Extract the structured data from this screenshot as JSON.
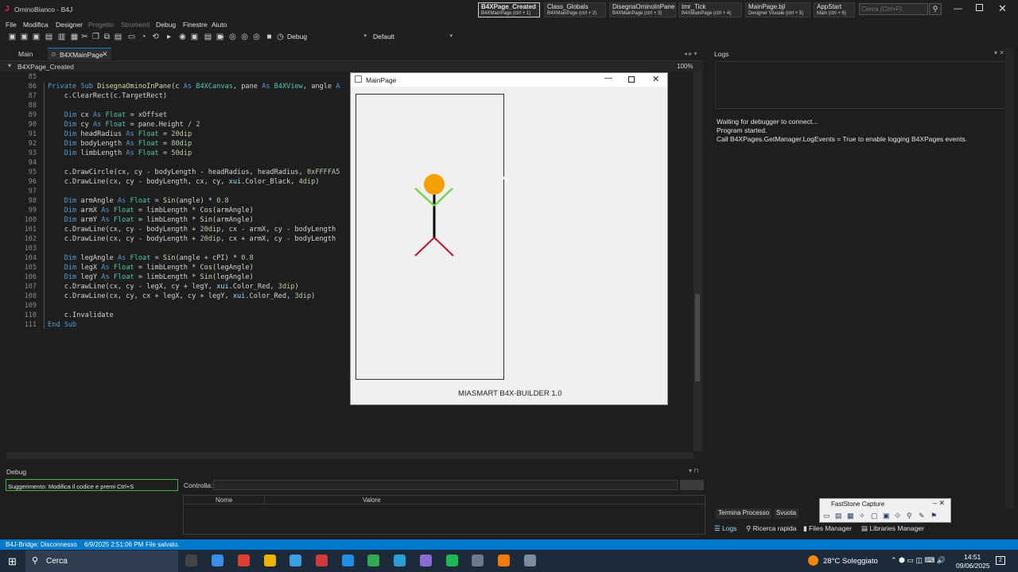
{
  "window": {
    "title": "OminoBianco - B4J"
  },
  "quick_tabs": [
    {
      "title": "B4XPage_Created",
      "sub": "B4XMainPage (ctrl + 1)"
    },
    {
      "title": "Class_Globals",
      "sub": "B4XMainPage (ctrl + 2)"
    },
    {
      "title": "DisegnaOminoInPane",
      "sub": "B4XMainPage (ctrl + 3)"
    },
    {
      "title": "tmr_Tick",
      "sub": "B4XMainPage (ctrl + 4)"
    },
    {
      "title": "MainPage.bjl",
      "sub": "Designer Visuale (ctrl + 5)"
    },
    {
      "title": "AppStart",
      "sub": "Main (ctrl + 6)"
    }
  ],
  "search": {
    "placeholder": "Cerca (Ctrl+F)"
  },
  "menu": [
    "File",
    "Modifica",
    "Designer",
    "Progetto",
    "Strumenti",
    "Debug",
    "Finestre",
    "Aiuto"
  ],
  "toolbar": {
    "config": "Debug",
    "build": "Default"
  },
  "editor_tabs": [
    "Main",
    "B4XMainPage"
  ],
  "sub_dropdown": "B4XPage_Created",
  "zoom": "100%",
  "code": [
    {
      "n": "85",
      "t": []
    },
    {
      "n": "86",
      "t": [
        [
          "kw",
          "Private Sub "
        ],
        [
          "fn",
          "DisegnaOminoInPane"
        ],
        [
          "id",
          "(c "
        ],
        [
          "kw",
          "As "
        ],
        [
          "ty",
          "B4XCanvas"
        ],
        [
          "id",
          ", pane "
        ],
        [
          "kw",
          "As "
        ],
        [
          "ty",
          "B4XView"
        ],
        [
          "id",
          ", angle "
        ],
        [
          "kw",
          "A"
        ]
      ]
    },
    {
      "n": "87",
      "t": [
        [
          "id",
          "    c.ClearRect(c.TargetRect)"
        ]
      ]
    },
    {
      "n": "88",
      "t": []
    },
    {
      "n": "89",
      "t": [
        [
          "kw",
          "    Dim "
        ],
        [
          "id",
          "cx "
        ],
        [
          "kw",
          "As "
        ],
        [
          "ty",
          "Float"
        ],
        [
          "id",
          " = xOffset"
        ]
      ]
    },
    {
      "n": "90",
      "t": [
        [
          "kw",
          "    Dim "
        ],
        [
          "id",
          "cy "
        ],
        [
          "kw",
          "As "
        ],
        [
          "ty",
          "Float"
        ],
        [
          "id",
          " = pane.Height / "
        ],
        [
          "nm",
          "2"
        ]
      ]
    },
    {
      "n": "91",
      "t": [
        [
          "kw",
          "    Dim "
        ],
        [
          "id",
          "headRadius "
        ],
        [
          "kw",
          "As "
        ],
        [
          "ty",
          "Float"
        ],
        [
          "id",
          " = "
        ],
        [
          "nm",
          "20dip"
        ]
      ]
    },
    {
      "n": "92",
      "t": [
        [
          "kw",
          "    Dim "
        ],
        [
          "id",
          "bodyLength "
        ],
        [
          "kw",
          "As "
        ],
        [
          "ty",
          "Float"
        ],
        [
          "id",
          " = "
        ],
        [
          "nm",
          "80dip"
        ]
      ]
    },
    {
      "n": "93",
      "t": [
        [
          "kw",
          "    Dim "
        ],
        [
          "id",
          "limbLength "
        ],
        [
          "kw",
          "As "
        ],
        [
          "ty",
          "Float"
        ],
        [
          "id",
          " = "
        ],
        [
          "nm",
          "50dip"
        ]
      ]
    },
    {
      "n": "94",
      "t": []
    },
    {
      "n": "95",
      "t": [
        [
          "id",
          "    c.DrawCircle(cx, cy - bodyLength - headRadius, headRadius, "
        ],
        [
          "nm",
          "0xFFFFA5"
        ]
      ]
    },
    {
      "n": "96",
      "t": [
        [
          "id",
          "    c.DrawLine(cx, cy - bodyLength, cx, cy, "
        ],
        [
          "bi",
          "xui"
        ],
        [
          "id",
          ".Color_Black, "
        ],
        [
          "nm",
          "4dip"
        ],
        [
          "id",
          ")"
        ]
      ]
    },
    {
      "n": "97",
      "t": []
    },
    {
      "n": "98",
      "t": [
        [
          "kw",
          "    Dim "
        ],
        [
          "id",
          "armAngle "
        ],
        [
          "kw",
          "As "
        ],
        [
          "ty",
          "Float"
        ],
        [
          "id",
          " = "
        ],
        [
          "fn",
          "Sin"
        ],
        [
          "id",
          "(angle) * "
        ],
        [
          "nm",
          "0.8"
        ]
      ]
    },
    {
      "n": "99",
      "t": [
        [
          "kw",
          "    Dim "
        ],
        [
          "id",
          "armX "
        ],
        [
          "kw",
          "As "
        ],
        [
          "ty",
          "Float"
        ],
        [
          "id",
          " = limbLength * "
        ],
        [
          "fn",
          "Cos"
        ],
        [
          "id",
          "(armAngle)"
        ]
      ]
    },
    {
      "n": "100",
      "t": [
        [
          "kw",
          "    Dim "
        ],
        [
          "id",
          "armY "
        ],
        [
          "kw",
          "As "
        ],
        [
          "ty",
          "Float"
        ],
        [
          "id",
          " = limbLength * "
        ],
        [
          "fn",
          "Sin"
        ],
        [
          "id",
          "(armAngle)"
        ]
      ]
    },
    {
      "n": "101",
      "t": [
        [
          "id",
          "    c.DrawLine(cx, cy - bodyLength + "
        ],
        [
          "nm",
          "20dip"
        ],
        [
          "id",
          ", cx - armX, cy - bodyLength"
        ]
      ]
    },
    {
      "n": "102",
      "t": [
        [
          "id",
          "    c.DrawLine(cx, cy - bodyLength + "
        ],
        [
          "nm",
          "20dip"
        ],
        [
          "id",
          ", cx + armX, cy - bodyLength"
        ]
      ]
    },
    {
      "n": "103",
      "t": []
    },
    {
      "n": "104",
      "t": [
        [
          "kw",
          "    Dim "
        ],
        [
          "id",
          "legAngle "
        ],
        [
          "kw",
          "As "
        ],
        [
          "ty",
          "Float"
        ],
        [
          "id",
          " = "
        ],
        [
          "fn",
          "Sin"
        ],
        [
          "id",
          "(angle + cPI) * "
        ],
        [
          "nm",
          "0.8"
        ]
      ]
    },
    {
      "n": "105",
      "t": [
        [
          "kw",
          "    Dim "
        ],
        [
          "id",
          "legX "
        ],
        [
          "kw",
          "As "
        ],
        [
          "ty",
          "Float"
        ],
        [
          "id",
          " = limbLength * "
        ],
        [
          "fn",
          "Cos"
        ],
        [
          "id",
          "(legAngle)"
        ]
      ]
    },
    {
      "n": "106",
      "t": [
        [
          "kw",
          "    Dim "
        ],
        [
          "id",
          "legY "
        ],
        [
          "kw",
          "As "
        ],
        [
          "ty",
          "Float"
        ],
        [
          "id",
          " = limbLength * "
        ],
        [
          "fn",
          "Sin"
        ],
        [
          "id",
          "(legAngle)"
        ]
      ]
    },
    {
      "n": "107",
      "t": [
        [
          "id",
          "    c.DrawLine(cx, cy - legX, cy + legY, "
        ],
        [
          "bi",
          "xui"
        ],
        [
          "id",
          ".Color_Red, "
        ],
        [
          "nm",
          "3dip"
        ],
        [
          "id",
          ")"
        ]
      ]
    },
    {
      "n": "108",
      "t": [
        [
          "id",
          "    c.DrawLine(cx, cy, cx + legX, cy + legY, "
        ],
        [
          "bi",
          "xui"
        ],
        [
          "id",
          ".Color_Red, "
        ],
        [
          "nm",
          "3dip"
        ],
        [
          "id",
          ")"
        ]
      ]
    },
    {
      "n": "109",
      "t": []
    },
    {
      "n": "110",
      "t": [
        [
          "id",
          "    c.Invalidate"
        ]
      ]
    },
    {
      "n": "111",
      "t": [
        [
          "kw",
          "End Sub"
        ]
      ]
    }
  ],
  "app_window": {
    "title": "MainPage",
    "footer": "MIASMART B4X-BUILDER 1.0"
  },
  "logs": {
    "title": "Logs",
    "lines": [
      "Waiting for debugger to connect...",
      "Program started.",
      "Call B4XPages.GetManager.LogEvents = True to enable logging B4XPages events."
    ],
    "btn_terminate": "Termina Processo",
    "btn_clear": "Svuota"
  },
  "bottom_tabs": [
    "Logs",
    "Ricerca rapida",
    "Files Manager",
    "Libraries Manager"
  ],
  "debug": {
    "title": "Debug",
    "hint": "Suggerimento: Modifica il codice e premi Ctrl+S",
    "control_label": "Controlla:",
    "col_name": "Nome",
    "col_value": "Valore"
  },
  "faststone": {
    "title": "FastStone Capture"
  },
  "status": {
    "bridge": "B4J-Bridge: Disconnesso",
    "time": "6/9/2025 2:51:06 PM",
    "saved": "File salvato."
  },
  "taskbar": {
    "search": "Cerca",
    "weather": "28°C Soleggiato",
    "clock": "14:51",
    "date": "09/06/2025",
    "notif": "2"
  },
  "colors": {
    "accent": "#007acc",
    "head": "#f5a000",
    "arms": "#7bd14a",
    "legs": "#c0122a"
  }
}
